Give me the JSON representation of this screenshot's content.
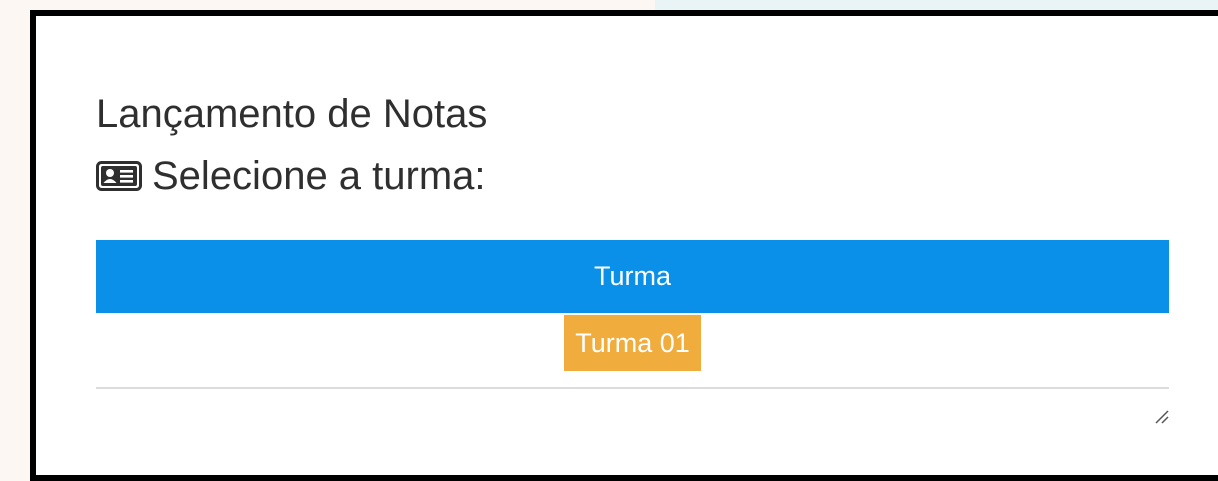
{
  "page": {
    "title": "Lançamento de Notas",
    "subtitle": "Selecione a turma:",
    "subtitle_icon": "id-card-icon"
  },
  "table": {
    "header": "Turma",
    "rows": [
      {
        "label": "Turma 01",
        "color": "#f0ad3d"
      }
    ],
    "header_color": "#0a90e8"
  }
}
